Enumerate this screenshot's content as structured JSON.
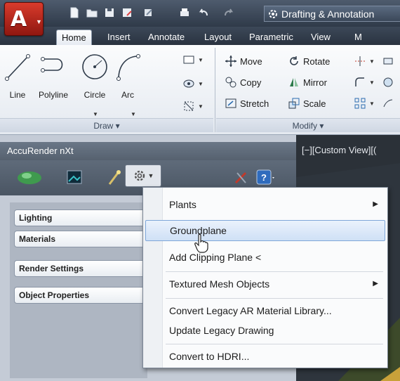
{
  "quick_access": {
    "workspace": "Drafting & Annotation"
  },
  "ribbon": {
    "tabs": [
      {
        "label": "Home",
        "active": true
      },
      {
        "label": "Insert"
      },
      {
        "label": "Annotate"
      },
      {
        "label": "Layout"
      },
      {
        "label": "Parametric"
      },
      {
        "label": "View"
      },
      {
        "label": "M"
      }
    ],
    "draw": {
      "line": "Line",
      "polyline": "Polyline",
      "circle": "Circle",
      "arc": "Arc",
      "panel_title": "Draw ▾"
    },
    "modify": {
      "move": "Move",
      "rotate": "Rotate",
      "copy": "Copy",
      "mirror": "Mirror",
      "stretch": "Stretch",
      "scale": "Scale",
      "panel_title": "Modify ▾"
    }
  },
  "palette": {
    "title": "AccuRender nXt",
    "tabs": [
      "Lighting",
      "Materials",
      "Render Settings",
      "Object Properties"
    ]
  },
  "viewport": {
    "label": "[−][Custom View][("
  },
  "context_menu": {
    "items": [
      {
        "label": "Plants",
        "submenu": true
      },
      {
        "label": "Groundplane",
        "highlighted": true
      },
      {
        "label": "Add Clipping Plane <"
      },
      {
        "label": "Textured Mesh Objects",
        "submenu": true
      },
      {
        "label": "Convert Legacy AR Material Library..."
      },
      {
        "label": "Update Legacy Drawing"
      },
      {
        "label": "Convert to HDRI..."
      }
    ]
  },
  "colors": {
    "app_button": "#c62a1f",
    "menu_highlight": "#cfe0f6",
    "palette_header": "#56616f"
  }
}
